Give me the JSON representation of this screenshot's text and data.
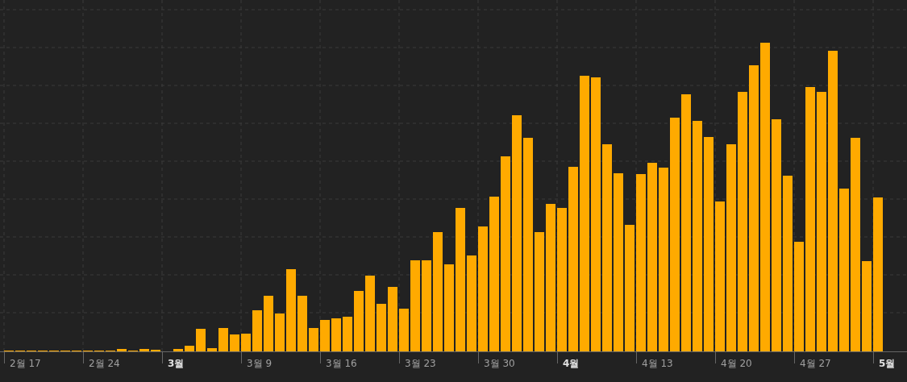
{
  "x_axis": {
    "labels": [
      {
        "text": "2월 17",
        "kind": "week"
      },
      {
        "text": "2월 24",
        "kind": "week"
      },
      {
        "text": "3월",
        "kind": "month"
      },
      {
        "text": "3월 9",
        "kind": "week"
      },
      {
        "text": "3월 16",
        "kind": "week"
      },
      {
        "text": "3월 23",
        "kind": "week"
      },
      {
        "text": "3월 30",
        "kind": "week"
      },
      {
        "text": "4월",
        "kind": "month"
      },
      {
        "text": "4월 13",
        "kind": "week"
      },
      {
        "text": "4월 20",
        "kind": "week"
      },
      {
        "text": "4월 27",
        "kind": "week"
      },
      {
        "text": "5월",
        "kind": "month"
      }
    ]
  }
}
